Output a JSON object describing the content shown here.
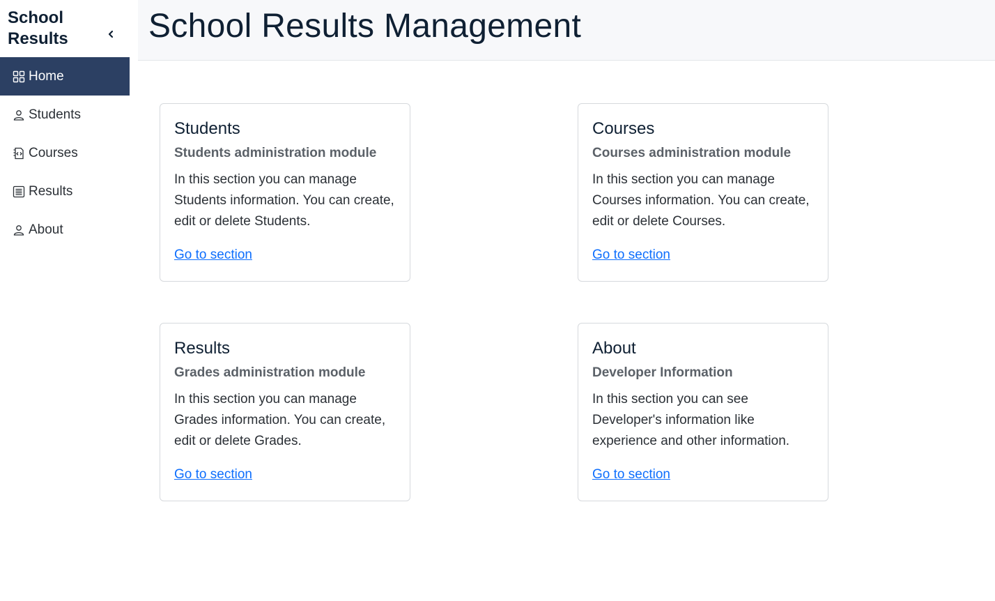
{
  "sidebar": {
    "brand": "School Results",
    "collapse_icon": "chevron-left-icon",
    "items": [
      {
        "label": "Home",
        "icon": "grid-icon",
        "active": true
      },
      {
        "label": "Students",
        "icon": "person-icon",
        "active": false
      },
      {
        "label": "Courses",
        "icon": "file-code-icon",
        "active": false
      },
      {
        "label": "Results",
        "icon": "list-card-icon",
        "active": false
      },
      {
        "label": "About",
        "icon": "person-icon",
        "active": false
      }
    ]
  },
  "header": {
    "title": "School Results Management"
  },
  "cards": [
    {
      "title": "Students",
      "subtitle": "Students administration module",
      "text": "In this section you can manage Students information. You can create, edit or delete Students.",
      "link": "Go to section"
    },
    {
      "title": "Courses",
      "subtitle": "Courses administration module",
      "text": "In this section you can manage Courses information. You can create, edit or delete Courses.",
      "link": "Go to section"
    },
    {
      "title": "Results",
      "subtitle": "Grades administration module",
      "text": "In this section you can manage Grades information. You can create, edit or delete Grades.",
      "link": "Go to section"
    },
    {
      "title": "About",
      "subtitle": "Developer Information",
      "text": "In this section you can see Developer's information like experience and other information.",
      "link": "Go to section"
    }
  ],
  "colors": {
    "sidebar_active_bg": "#2c4063",
    "link": "#0d6efd",
    "title": "#0f2033",
    "header_bg": "#f7f8fa"
  }
}
